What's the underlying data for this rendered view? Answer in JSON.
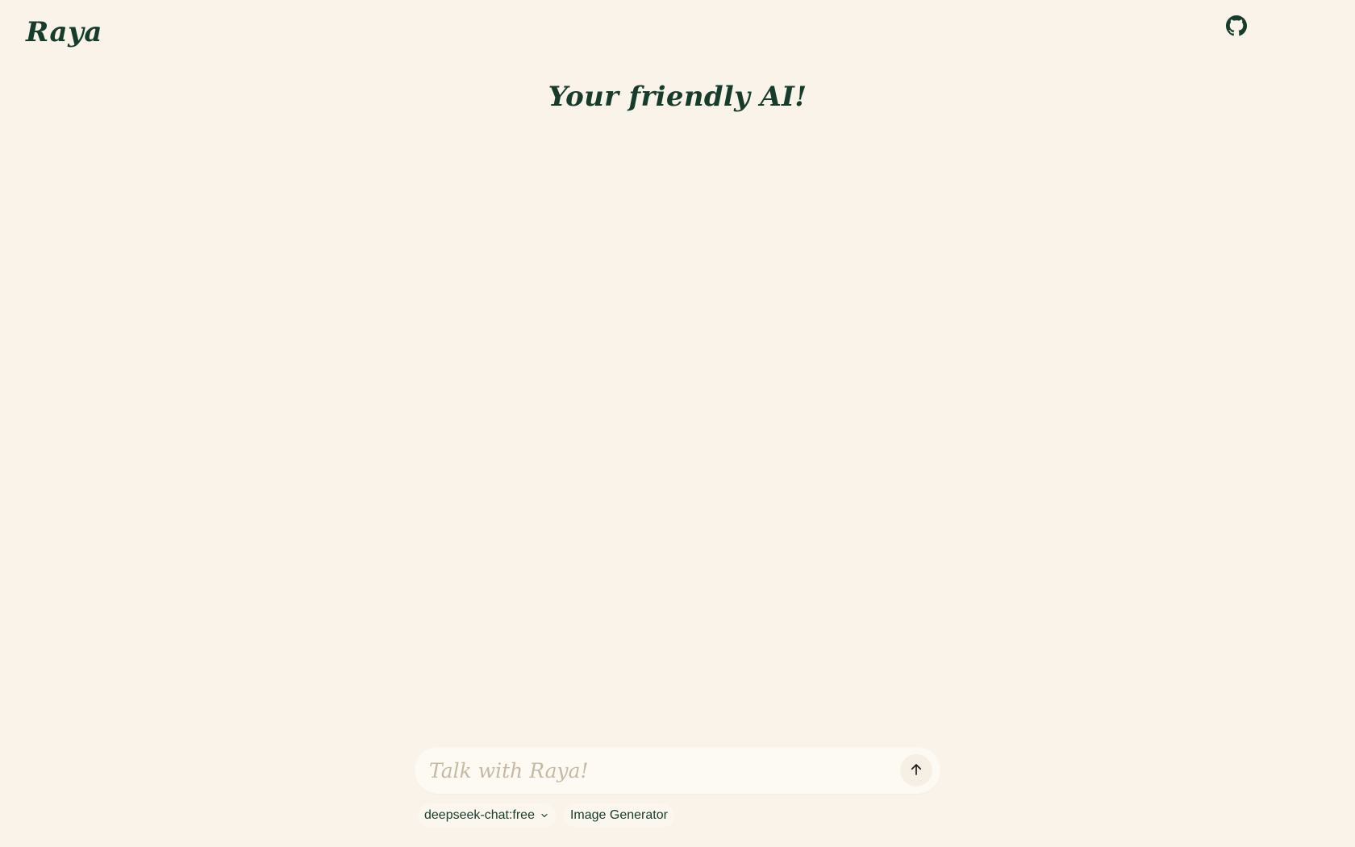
{
  "header": {
    "brand": "Raya",
    "github_icon": "github-icon"
  },
  "hero": {
    "tagline": "Your friendly AI!"
  },
  "composer": {
    "placeholder": "Talk with Raya!",
    "value": "",
    "send_icon": "arrow-up-icon"
  },
  "options": {
    "model_selected": "deepseek-chat:free",
    "model_dropdown_icon": "chevron-down-icon",
    "image_generator_label": "Image Generator"
  },
  "colors": {
    "background": "#faf3ea",
    "accent": "#163d2c",
    "placeholder": "#c6b9a4",
    "composer_bg": "#fdfaf4"
  }
}
